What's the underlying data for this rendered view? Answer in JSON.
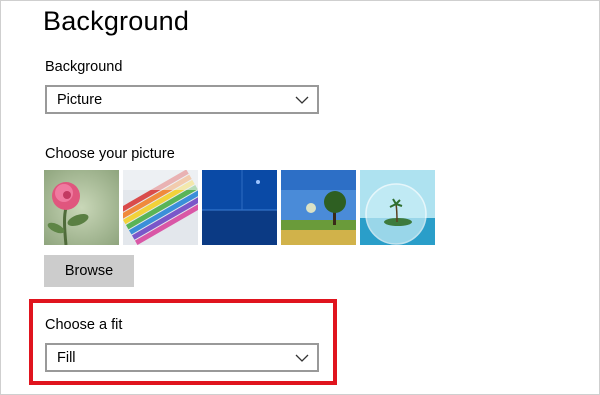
{
  "page": {
    "title": "Background"
  },
  "background_section": {
    "label": "Background",
    "dropdown_value": "Picture"
  },
  "picture_section": {
    "label": "Choose your picture",
    "thumbnails": [
      {
        "name": "pink-rose-thumbnail"
      },
      {
        "name": "colored-pencils-thumbnail"
      },
      {
        "name": "blue-abstract-thumbnail"
      },
      {
        "name": "tree-landscape-thumbnail"
      },
      {
        "name": "island-bubble-thumbnail"
      }
    ],
    "browse_label": "Browse"
  },
  "fit_section": {
    "label": "Choose a fit",
    "dropdown_value": "Fill"
  },
  "icons": {
    "dropdown": "chevron-down-icon"
  },
  "colors": {
    "highlight": "#e0141e",
    "button_bg": "#cccccc",
    "border": "#999999"
  }
}
